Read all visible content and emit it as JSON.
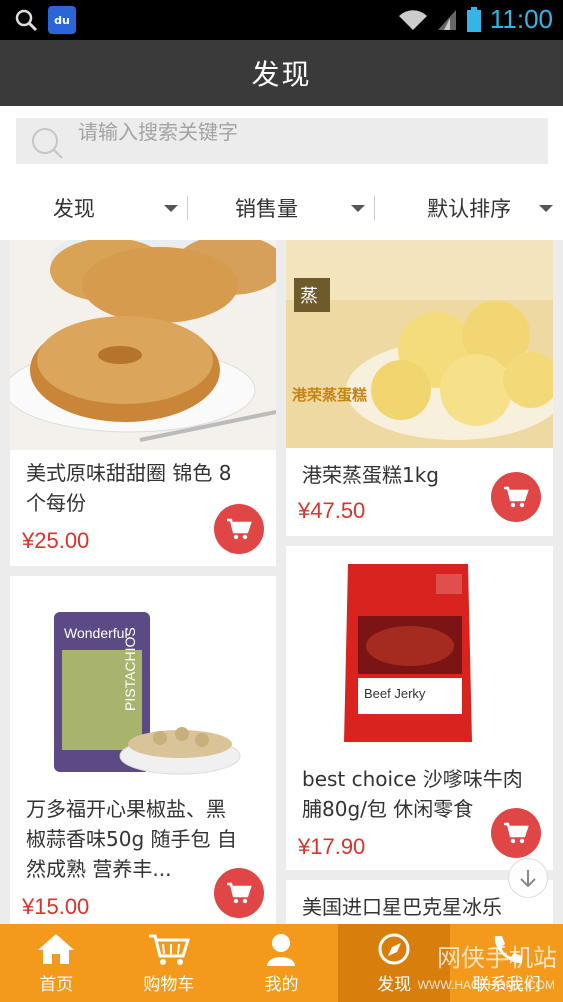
{
  "status_bar": {
    "time": "11:00",
    "app_badge": "du",
    "icons": [
      "search-icon",
      "baidu-app-icon",
      "wifi-icon",
      "signal-icon",
      "battery-icon"
    ]
  },
  "header": {
    "title": "发现"
  },
  "search": {
    "placeholder": "请输入搜索关键字"
  },
  "filters": [
    {
      "label": "发现"
    },
    {
      "label": "销售量"
    },
    {
      "label": "默认排序"
    }
  ],
  "products": [
    {
      "name_line1": "美式原味甜甜圈 锦色 8",
      "name_line2": "个每份",
      "price": "¥25.00",
      "image": "donut-image"
    },
    {
      "name_line1": "港荣蒸蛋糕1kg",
      "price": "¥47.50",
      "image": "steamed-cake-image",
      "brand_badge": "蒸",
      "brand_text": "港荣蒸蛋糕"
    },
    {
      "name_line1": "万多福开心果椒盐、黑",
      "name_line2": "椒蒜香味50g 随手包 自",
      "name_line3": "然成熟 营养丰...",
      "price": "¥15.00",
      "image": "pistachio-image",
      "pack_brand": "Wonderful",
      "pack_text": "PISTACHIOS"
    },
    {
      "name_line1": "best choice 沙嗲味牛肉",
      "name_line2": "脯80g/包 休闲零食",
      "price": "¥17.90",
      "image": "beef-jerky-image",
      "pack_text": "Beef Jerky"
    },
    {
      "name_line1": "美国进口星巴克星冰乐"
    }
  ],
  "bottom_nav": [
    {
      "label": "首页",
      "icon": "home-icon"
    },
    {
      "label": "购物车",
      "icon": "cart-icon"
    },
    {
      "label": "我的",
      "icon": "user-icon"
    },
    {
      "label": "发现",
      "icon": "discover-icon",
      "active": true
    },
    {
      "label": "联系我们",
      "icon": "phone-icon"
    }
  ],
  "watermark": {
    "text": "网侠手机站",
    "url": "WWW.HACKHOME.COM"
  },
  "colors": {
    "accent": "#f39a1d",
    "price": "#d9342b",
    "cart_button": "#e04646",
    "title_bar": "#3a3a3a"
  }
}
